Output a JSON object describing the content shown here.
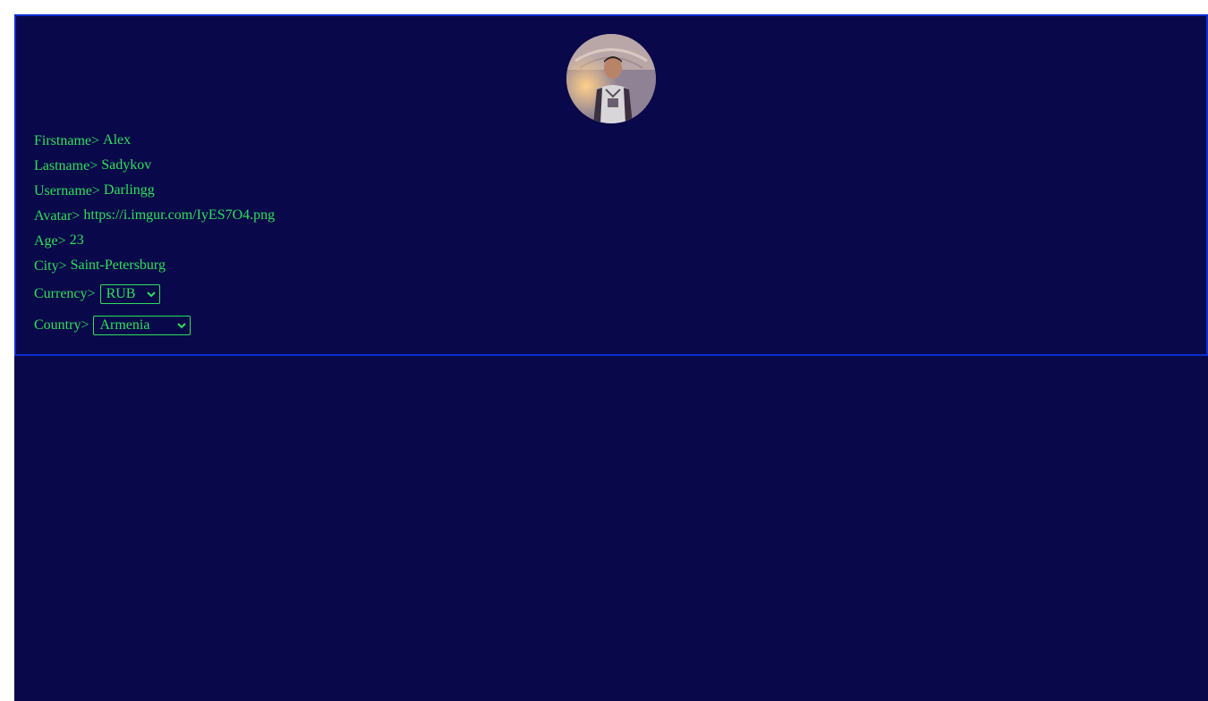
{
  "profile": {
    "avatar_icon": "user-avatar-photo",
    "fields": {
      "firstname": {
        "label": "Firstname>",
        "value": "Alex"
      },
      "lastname": {
        "label": "Lastname>",
        "value": "Sadykov"
      },
      "username": {
        "label": "Username>",
        "value": "Darlingg"
      },
      "avatar": {
        "label": "Avatar>",
        "value": "https://i.imgur.com/IyES7O4.png"
      },
      "age": {
        "label": "Age>",
        "value": "23"
      },
      "city": {
        "label": "City>",
        "value": "Saint-Petersburg"
      }
    },
    "currency": {
      "label": "Currency>",
      "selected": "RUB"
    },
    "country": {
      "label": "Country>",
      "selected": "Armenia"
    }
  },
  "colors": {
    "background": "#09084a",
    "border": "#0c2fd0",
    "text": "#2de05a"
  }
}
